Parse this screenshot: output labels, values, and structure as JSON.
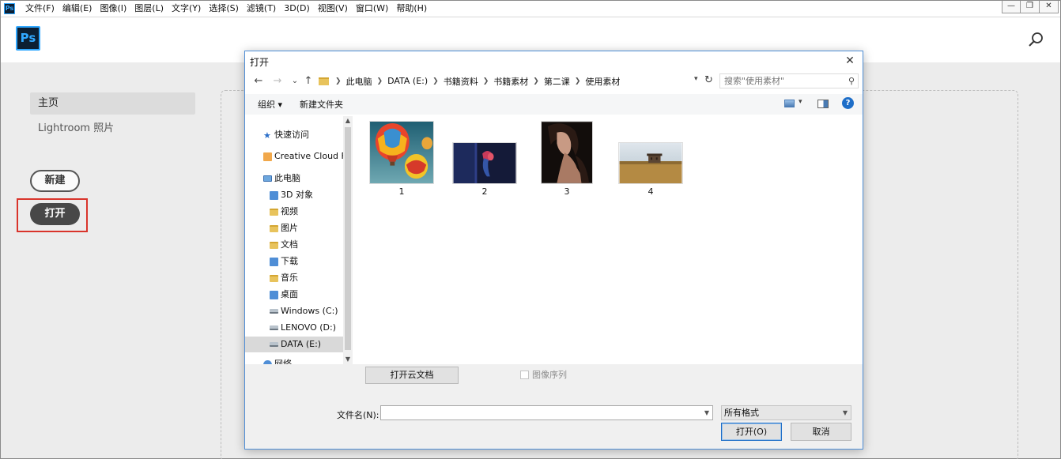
{
  "app": {
    "badge": "Ps",
    "logo_text": "Ps",
    "menus": [
      "文件(F)",
      "编辑(E)",
      "图像(I)",
      "图层(L)",
      "文字(Y)",
      "选择(S)",
      "滤镜(T)",
      "3D(D)",
      "视图(V)",
      "窗口(W)",
      "帮助(H)"
    ],
    "window_controls": {
      "minimize": "—",
      "restore": "❐",
      "close": "✕"
    }
  },
  "sidebar": {
    "home": "主页",
    "lightroom": "Lightroom 照片",
    "new_button": "新建",
    "open_button": "打开"
  },
  "dialog": {
    "title": "打开",
    "close": "✕",
    "nav": {
      "back": "←",
      "forward": "→",
      "recent": "⌄",
      "up": "↑",
      "refresh": "↻"
    },
    "breadcrumb": [
      "此电脑",
      "DATA (E:)",
      "书籍资料",
      "书籍素材",
      "第二课",
      "使用素材"
    ],
    "search_placeholder": "搜索\"使用素材\"",
    "toolbar": {
      "organize": "组织 ▾",
      "new_folder": "新建文件夹",
      "help": "?"
    },
    "tree": [
      {
        "label": "快速访问",
        "icon": "star-icon"
      },
      {
        "label": "Creative Cloud Fi",
        "icon": "creative-cloud-icon"
      },
      {
        "label": "此电脑",
        "icon": "computer-icon"
      },
      {
        "label": "3D 对象",
        "icon": "folder-3d-icon"
      },
      {
        "label": "视频",
        "icon": "folder-video-icon"
      },
      {
        "label": "图片",
        "icon": "folder-pictures-icon"
      },
      {
        "label": "文档",
        "icon": "folder-documents-icon"
      },
      {
        "label": "下载",
        "icon": "folder-downloads-icon"
      },
      {
        "label": "音乐",
        "icon": "folder-music-icon"
      },
      {
        "label": "桌面",
        "icon": "folder-desktop-icon"
      },
      {
        "label": "Windows (C:)",
        "icon": "drive-windows-icon"
      },
      {
        "label": "LENOVO (D:)",
        "icon": "drive-icon"
      },
      {
        "label": "DATA (E:)",
        "icon": "drive-icon",
        "selected": true
      },
      {
        "label": "网络",
        "icon": "network-icon"
      }
    ],
    "files": [
      {
        "name": "1",
        "image": "hot air balloons"
      },
      {
        "name": "2",
        "image": "dark blue scene with red flower"
      },
      {
        "name": "3",
        "image": "woman portrait"
      },
      {
        "name": "4",
        "image": "house in field"
      }
    ],
    "open_cloud_button": "打开云文档",
    "image_sequence_label": "图像序列",
    "filename_label": "文件名(N):",
    "filename_value": "",
    "format_value": "所有格式",
    "open_button": "打开(O)",
    "cancel_button": "取消"
  }
}
